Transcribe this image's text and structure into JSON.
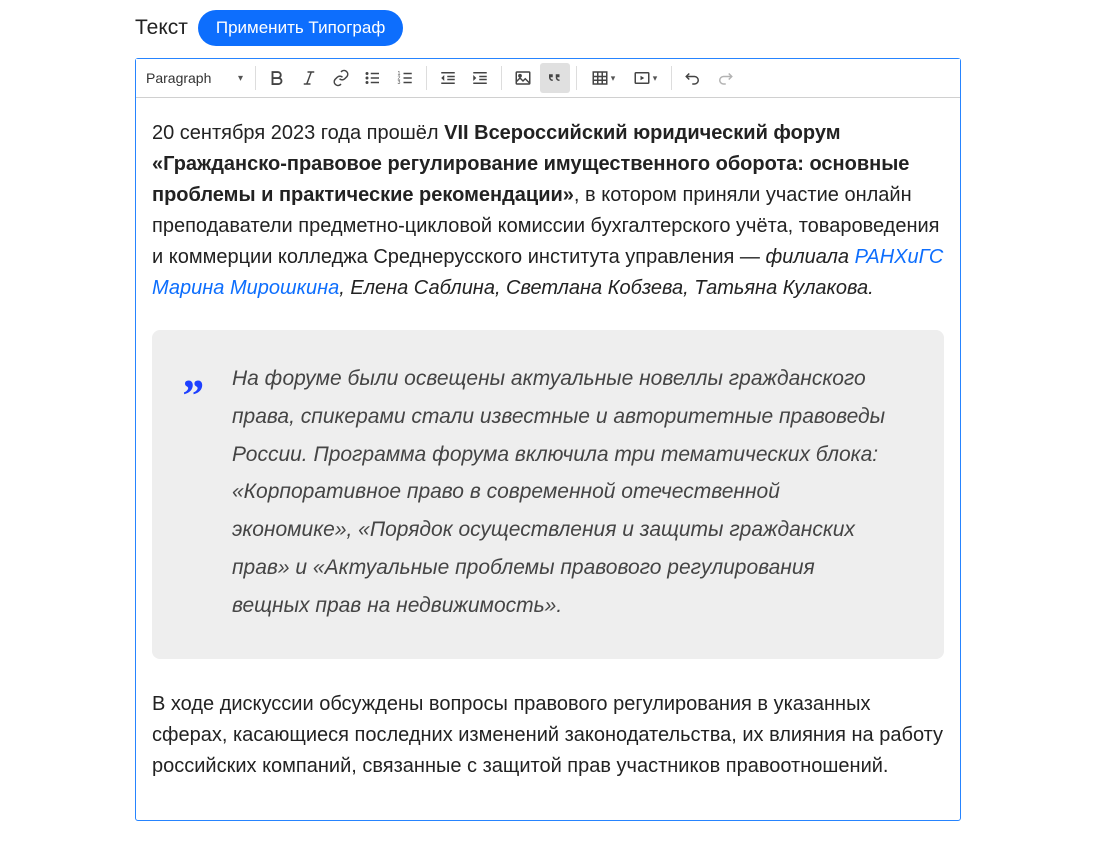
{
  "header": {
    "label": "Текст",
    "apply_button": "Применить Типограф"
  },
  "toolbar": {
    "format": "Paragraph"
  },
  "content": {
    "p1_prefix": "20 сентября 2023 года прошёл ",
    "p1_bold": "VII Всероссийский юридический форум «Гражданско-правовое регулирование имущественного оборота: основные проблемы и практические рекомендации»",
    "p1_mid": ", в котором приняли участие онлайн преподаватели предметно-цикловой комиссии бухгалтерского учёта, товароведения и коммерции колледжа Среднерусского института управления — ",
    "p1_italic_prefix": "филиала ",
    "p1_link": "РАНХиГС Марина Мирошкина",
    "p1_italic_suffix": ", Елена Саблина, Светлана Кобзева, Татьяна Кулакова.",
    "blockquote": "На форуме были освещены актуальные новеллы гражданского права, спикерами стали известные и авторитетные правоведы России. Программа форума включила три тематических блока: «Корпоративное право в современной отечественной экономике», «Порядок осуществления и защиты гражданских прав» и «Актуальные проблемы правового регулирования вещных прав на недвижимость».",
    "p2": "В ходе дискуссии обсуждены вопросы правового регулирования в указанных сферах, касающиеся последних изменений законодательства, их влияния на работу российских компаний, связанные с защитой прав участников правоотношений."
  }
}
